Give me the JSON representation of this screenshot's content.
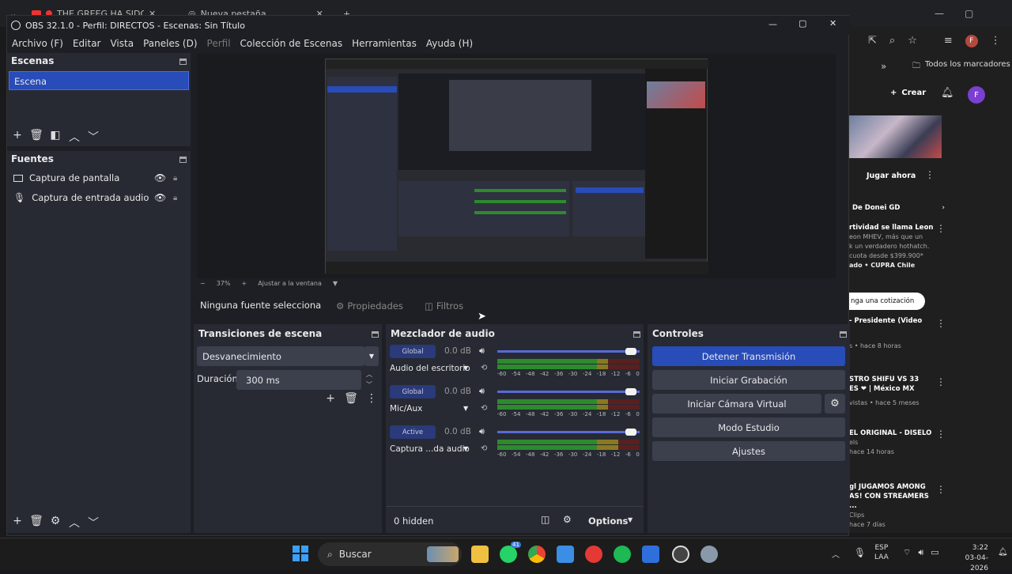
{
  "browser": {
    "tab1": "THE GREEG HA SIDO ABATI",
    "tab2": "Nueva pestaña",
    "bookmarks": "Todos los marcadores",
    "crear": "Crear",
    "avatar": "F",
    "play_now": "Jugar ahora",
    "channel_chip": "De Donei GD",
    "ad_title": "rtividad se llama Leon",
    "ad_lines": [
      "eon MHEV, más que un",
      "k un verdadero hothatch.",
      "cuota desde $399.900*"
    ],
    "ad_sponsor": "ado • CUPRA Chile",
    "ad_button": "nga una cotización",
    "videos": [
      {
        "title": "- Presidente (Video",
        "meta": "s • hace 8 horas"
      },
      {
        "title": "STRO SHIFU VS 33\nES ❤ | México MX",
        "meta": "vistas • hace 5 meses"
      },
      {
        "title": "EL ORIGINAL - DISELO",
        "meta": "els",
        "meta2": "hace 14 horas"
      },
      {
        "title": "gl JUGAMOS AMONG\nAS! CON STREAMERS ...",
        "meta": "Clips",
        "meta2": "hace 7 días"
      }
    ]
  },
  "obs": {
    "title": "OBS 32.1.0 - Perfil: DIRECTOS - Escenas: Sin Título",
    "menu": [
      "Archivo (F)",
      "Editar",
      "Vista",
      "Paneles (D)",
      "Perfil",
      "Colección de Escenas",
      "Herramientas",
      "Ayuda (H)"
    ],
    "scenes_title": "Escenas",
    "scenes": [
      "Escena"
    ],
    "sources_title": "Fuentes",
    "sources": [
      "Captura de pantalla",
      "Captura de entrada audio"
    ],
    "preview": {
      "zoom": "37%",
      "fit": "Ajustar a la ventana"
    },
    "context_bar": {
      "no_source": "Ninguna fuente selecciona",
      "properties": "Propiedades",
      "filters": "Filtros"
    },
    "transitions": {
      "title": "Transiciones de escena",
      "selected": "Desvanecimiento",
      "duration_label": "Duración",
      "duration_value": "300 ms"
    },
    "mixer": {
      "title": "Mezclador de audio",
      "channels": [
        {
          "badge": "Global",
          "db": "0.0 dB",
          "name": "Audio del escritorio",
          "level": 0.78
        },
        {
          "badge": "Global",
          "db": "0.0 dB",
          "name": "Mic/Aux",
          "level": 0.78
        },
        {
          "badge": "Active",
          "db": "0.0 dB",
          "name": "Captura ...da audio",
          "level": 0.85
        }
      ],
      "scale": [
        "-60",
        "-54",
        "-48",
        "-42",
        "-36",
        "-30",
        "-24",
        "-18",
        "-12",
        "-6",
        "0"
      ],
      "hidden": "0 hidden",
      "options": "Options"
    },
    "controls": {
      "title": "Controles",
      "buttons": [
        "Detener Transmisión",
        "Iniciar Grabación",
        "Iniciar Cámara Virtual",
        "Modo Estudio",
        "Ajustes"
      ]
    }
  },
  "taskbar": {
    "search": "Buscar",
    "lang1": "ESP",
    "lang2": "LAA",
    "time": "3:22",
    "date": "03-04-2026",
    "badge_count": "41"
  },
  "colors": {
    "accent": "#284cb8",
    "dock": "#272a33",
    "bg": "#1e1f24"
  }
}
